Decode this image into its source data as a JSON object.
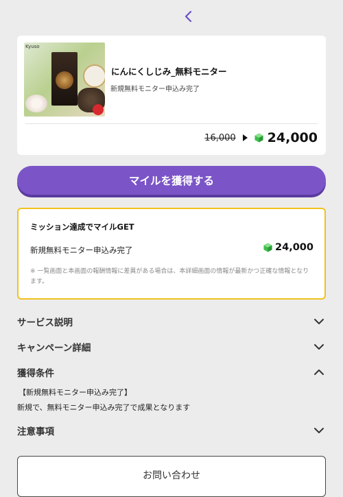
{
  "nav": {
    "back_icon": "chevron-left-icon"
  },
  "product": {
    "brand": "Kyuso",
    "title": "にんにくしじみ_無料モニター",
    "subtitle": "新規無料モニター申込み完了",
    "old_price": "16,000",
    "new_price": "24,000"
  },
  "cta": {
    "label": "マイルを獲得する"
  },
  "mission": {
    "heading": "ミッション達成でマイルGET",
    "label": "新規無料モニター申込み完了",
    "reward": "24,000",
    "note": "※ 一覧画面と本画面の報酬情報に差異がある場合は、本詳細画面の情報が最新かつ正確な情報となります。"
  },
  "sections": {
    "service": "サービス説明",
    "campaign": "キャンペーン詳細",
    "conditions": "獲得条件",
    "notes": "注意事項"
  },
  "conditions": {
    "line1": "【新規無料モニター申込み完了】",
    "line2": "新規で、無料モニター申込み完了で成果となります"
  },
  "contact": {
    "label": "お問い合わせ"
  },
  "colors": {
    "accent": "#7b55c7",
    "mission_border": "#f2c11c",
    "gem": "#3fbf4a",
    "background": "#ececec"
  }
}
